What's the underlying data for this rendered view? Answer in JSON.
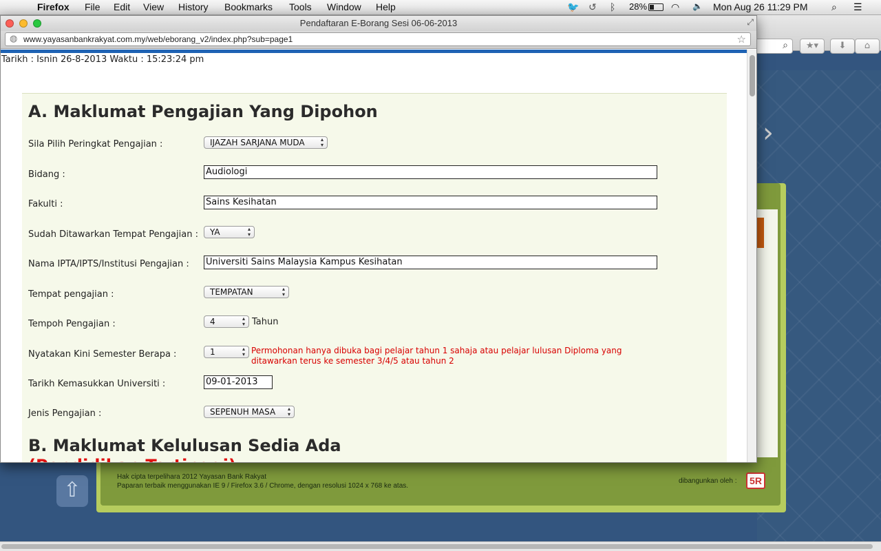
{
  "menubar": {
    "app_name": "Firefox",
    "menus": [
      "File",
      "Edit",
      "View",
      "History",
      "Bookmarks",
      "Tools",
      "Window",
      "Help"
    ],
    "battery": "28%",
    "clock": "Mon Aug 26  11:29 PM"
  },
  "window": {
    "title": "Pendaftaran E-Borang Sesi 06-06-2013",
    "url": "www.yayasanbankrakyat.com.my/web/eborang_v2/index.php?sub=page1"
  },
  "page": {
    "datetime": "Tarikh : Isnin 26-8-2013 Waktu : 15:23:24 pm",
    "section_a_title": "A. Maklumat Pengajian Yang Dipohon",
    "fields": {
      "peringkat": {
        "label": "Sila Pilih Peringkat Pengajian :",
        "value": "IJAZAH SARJANA MUDA"
      },
      "bidang": {
        "label": "Bidang :",
        "value": "Audiologi"
      },
      "fakulti": {
        "label": "Fakulti :",
        "value": "Sains Kesihatan"
      },
      "ditawarkan": {
        "label": "Sudah Ditawarkan Tempat Pengajian :",
        "value": "YA"
      },
      "institusi": {
        "label": "Nama IPTA/IPTS/Institusi Pengajian :",
        "value": "Universiti Sains Malaysia Kampus Kesihatan"
      },
      "tempat": {
        "label": "Tempat pengajian :",
        "value": "TEMPATAN"
      },
      "tempoh": {
        "label": "Tempoh Pengajian :",
        "value": "4",
        "unit": "Tahun"
      },
      "semester": {
        "label": "Nyatakan Kini Semester Berapa :",
        "value": "1",
        "note": "Permohonan hanya dibuka bagi pelajar tahun 1 sahaja atau pelajar lulusan Diploma yang ditawarkan terus ke semester 3/4/5 atau tahun 2"
      },
      "tarikh_masuk": {
        "label": "Tarikh Kemasukkan Universiti :",
        "value": "09-01-2013"
      },
      "jenis": {
        "label": "Jenis Pengajian :",
        "value": "SEPENUH MASA"
      }
    },
    "section_b_title": "B. Maklumat Kelulusan Sedia Ada",
    "section_b_sub": "(Pendidikan Tertinggi)"
  },
  "background_page": {
    "footer_line1": "Hak cipta terpelihara 2012 Yayasan Bank Rakyat",
    "footer_line2": "Paparan terbaik menggunakan IE 9 / Firefox 3.6 / Chrome, dengan resolusi 1024 x 768 ke atas.",
    "built_by": "dibangunkan oleh :",
    "logo_text": "5R"
  }
}
